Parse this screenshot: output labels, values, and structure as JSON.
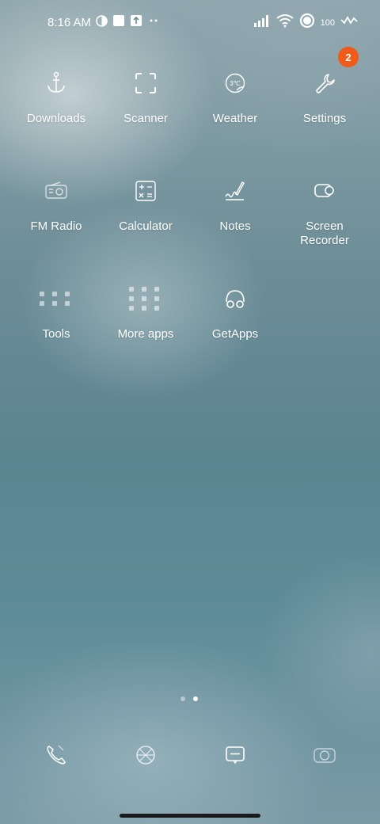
{
  "status_bar": {
    "time": "8:16 AM",
    "battery_level": "100"
  },
  "settings_badge": "2",
  "apps": [
    {
      "label": "Downloads",
      "icon": "anchor-icon"
    },
    {
      "label": "Scanner",
      "icon": "scan-frame-icon"
    },
    {
      "label": "Weather",
      "icon": "weather-icon",
      "icon_text": "3℃"
    },
    {
      "label": "Settings",
      "icon": "wrench-icon"
    },
    {
      "label": "FM Radio",
      "icon": "radio-icon"
    },
    {
      "label": "Calculator",
      "icon": "calculator-icon"
    },
    {
      "label": "Notes",
      "icon": "pen-icon"
    },
    {
      "label": "Screen\nRecorder",
      "icon": "screen-recorder-icon"
    },
    {
      "label": "Tools",
      "icon": "folder-icon"
    },
    {
      "label": "More apps",
      "icon": "folder-icon"
    },
    {
      "label": "GetApps",
      "icon": "getapps-icon"
    }
  ],
  "page_indicator": {
    "pages": 2,
    "current": 2
  },
  "dock": [
    {
      "icon": "phone-icon"
    },
    {
      "icon": "browser-icon"
    },
    {
      "icon": "messages-icon"
    },
    {
      "icon": "camera-icon"
    }
  ]
}
